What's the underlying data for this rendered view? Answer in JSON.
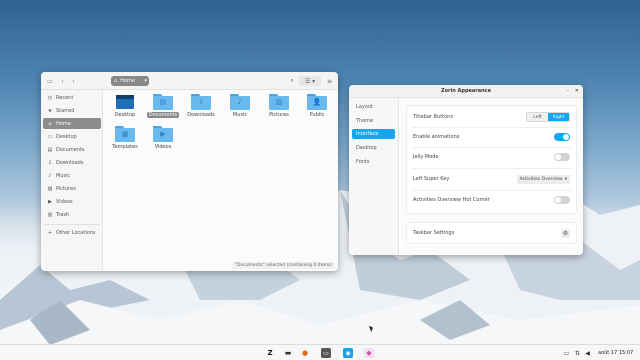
{
  "file_manager": {
    "breadcrumb": "Home",
    "sidebar": [
      {
        "label": "Recent",
        "icon": "recent-icon",
        "glyph": "◷"
      },
      {
        "label": "Starred",
        "icon": "star-icon",
        "glyph": "★"
      },
      {
        "label": "Home",
        "icon": "home-icon",
        "glyph": "⌂"
      },
      {
        "label": "Desktop",
        "icon": "desktop-icon",
        "glyph": "▭"
      },
      {
        "label": "Documents",
        "icon": "document-icon",
        "glyph": "▤"
      },
      {
        "label": "Downloads",
        "icon": "download-icon",
        "glyph": "⇩"
      },
      {
        "label": "Music",
        "icon": "music-icon",
        "glyph": "♪"
      },
      {
        "label": "Pictures",
        "icon": "pictures-icon",
        "glyph": "▨"
      },
      {
        "label": "Videos",
        "icon": "videos-icon",
        "glyph": "▶"
      },
      {
        "label": "Trash",
        "icon": "trash-icon",
        "glyph": "🗑"
      },
      {
        "label": "Other Locations",
        "icon": "add-icon",
        "glyph": "+"
      }
    ],
    "files": [
      {
        "label": "Desktop",
        "glyph": ""
      },
      {
        "label": "Documents",
        "glyph": "▤"
      },
      {
        "label": "Downloads",
        "glyph": "⇩"
      },
      {
        "label": "Music",
        "glyph": "♪"
      },
      {
        "label": "Pictures",
        "glyph": "▨"
      },
      {
        "label": "Public",
        "glyph": "👤"
      },
      {
        "label": "Templates",
        "glyph": "▦"
      },
      {
        "label": "Videos",
        "glyph": "▶"
      }
    ],
    "status": "\"Documents\" selected (containing 0 items)"
  },
  "appearance": {
    "title": "Zorin Appearance",
    "nav": [
      "Layout",
      "Theme",
      "Interface",
      "Desktop",
      "Fonts"
    ],
    "active_nav": 2,
    "titlebar_label": "Titlebar Buttons",
    "titlebar_options": [
      "Left",
      "Right"
    ],
    "titlebar_selected": "Right",
    "animations_label": "Enable animations",
    "animations_on": true,
    "jelly_label": "Jelly Mode",
    "jelly_on": false,
    "super_label": "Left Super Key",
    "super_value": "Activities Overview",
    "hotcorner_label": "Activities Overview Hot Corner",
    "hotcorner_on": false,
    "taskbar_label": "Taskbar Settings"
  },
  "taskbar": {
    "date": "août 17",
    "time": "15:07"
  },
  "colors": {
    "accent": "#15a6f0",
    "folder": "#69b8ee"
  }
}
